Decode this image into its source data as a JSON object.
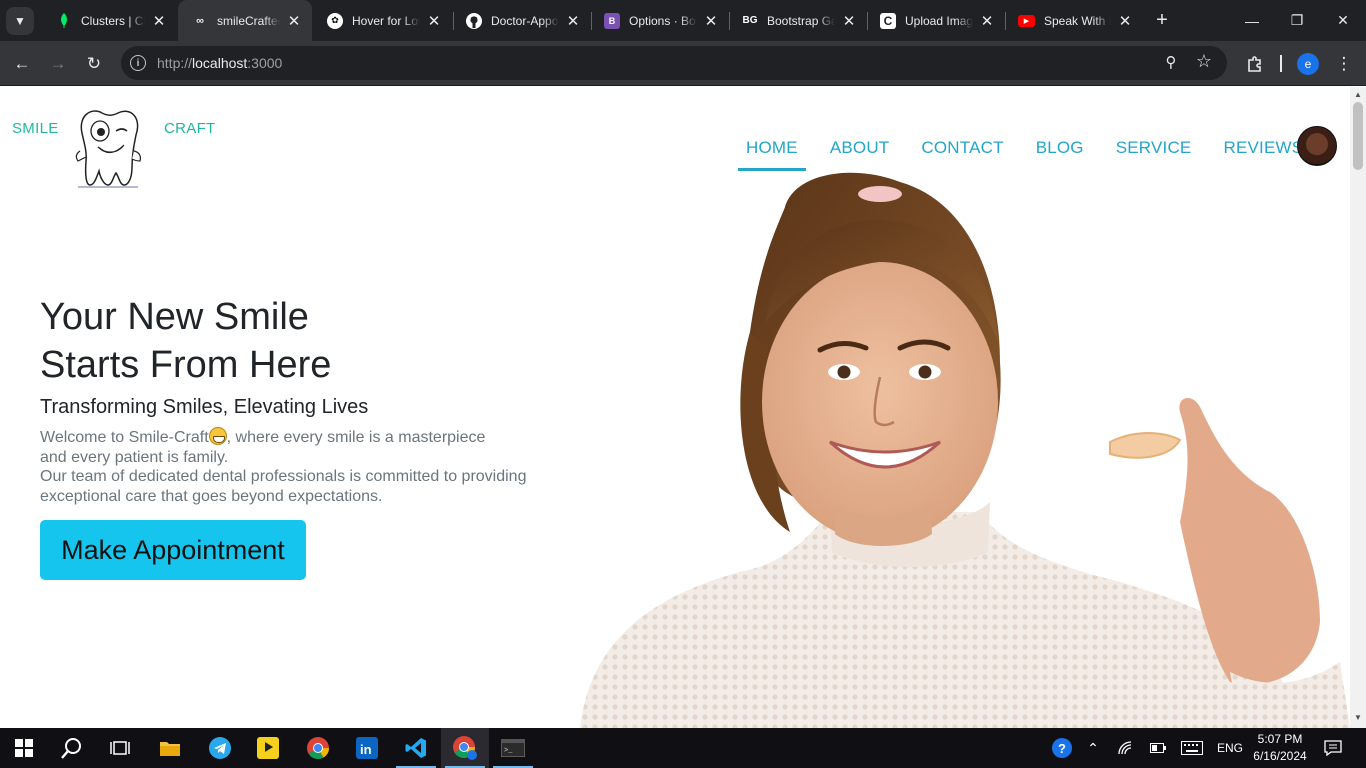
{
  "browser": {
    "tabs": [
      {
        "title": "Clusters | Cloud: MongoDB Cloud",
        "favicon": "mongodb-leaf-icon",
        "color": "#00ed64",
        "active": false
      },
      {
        "title": "smileCrafted",
        "favicon": "github-pages-icon",
        "color": "#e8eaed",
        "active": true
      },
      {
        "title": "Hover for Low Vision",
        "favicon": "openai-icon",
        "color": "#ffffff",
        "active": false
      },
      {
        "title": "Doctor-Appointment",
        "favicon": "github-icon",
        "color": "#ffffff",
        "active": false
      },
      {
        "title": "Options · Bootstrap",
        "favicon": "bootstrap-icon",
        "color": "#7952b3",
        "active": false
      },
      {
        "title": "Bootstrap Gallery",
        "favicon": "bg-icon",
        "color": "#ffffff",
        "active": false
      },
      {
        "title": "Upload Image",
        "favicon": "c-icon",
        "color": "#ffffff",
        "active": false
      },
      {
        "title": "Speak With Me",
        "favicon": "youtube-icon",
        "color": "#ff0000",
        "active": false
      }
    ],
    "url_scheme": "http://",
    "url_host": "localhost",
    "url_rest": ":3000",
    "profile_initial": "e"
  },
  "page": {
    "logo": {
      "left": "SMILE",
      "right": "CRAFT",
      "mascot": "tooth-mascot-icon"
    },
    "nav": [
      {
        "label": "HOME",
        "active": true
      },
      {
        "label": "ABOUT",
        "active": false
      },
      {
        "label": "CONTACT",
        "active": false
      },
      {
        "label": "BLOG",
        "active": false
      },
      {
        "label": "SERVICE",
        "active": false
      },
      {
        "label": "REVIEWS",
        "active": false
      }
    ],
    "hero": {
      "title_line1": "Your New Smile",
      "title_line2": "Starts From Here",
      "subtitle": "Transforming Smiles, Elevating Lives",
      "text_a": "Welcome to Smile-Craft",
      "text_b": ", where every smile is a masterpiece",
      "text_c": "and every patient is family.",
      "text_d": "Our team of dedicated dental professionals is committed to providing",
      "text_e": "exceptional care that goes beyond expectations.",
      "cta": "Make Appointment"
    },
    "colors": {
      "accent": "#22a6c9",
      "logo": "#1fb8a0",
      "cta": "#16c5ee"
    }
  },
  "taskbar": {
    "apps": [
      "windows-start-icon",
      "search-icon",
      "task-view-icon",
      "file-explorer-icon",
      "telegram-icon",
      "pot-player-icon",
      "chrome-icon",
      "linkedin-icon",
      "vscode-icon",
      "chrome-profile-icon",
      "terminal-icon"
    ],
    "language": "ENG",
    "time": "5:07 PM",
    "date": "6/16/2024"
  }
}
